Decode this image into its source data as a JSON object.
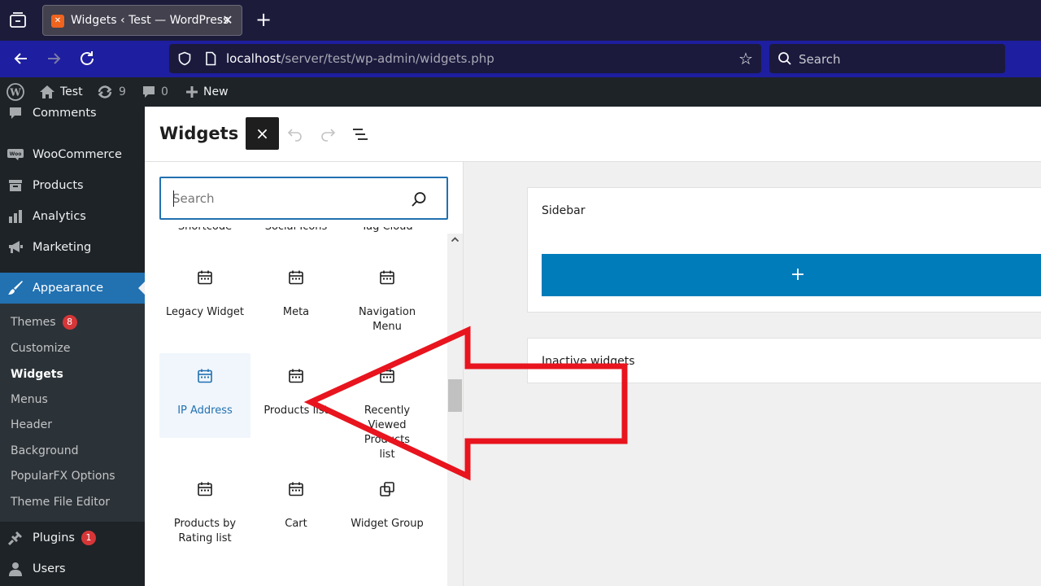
{
  "browser": {
    "tab_title": "Widgets ‹ Test — WordPress",
    "url_host": "localhost",
    "url_path": "/server/test/wp-admin/widgets.php",
    "search_placeholder": "Search"
  },
  "adminbar": {
    "site_name": "Test",
    "updates_count": "9",
    "comments_count": "0",
    "new_label": "New"
  },
  "sidebar": {
    "items": [
      {
        "label": "Comments",
        "icon": "comment-icon"
      },
      {
        "label": "WooCommerce",
        "icon": "woocommerce-icon"
      },
      {
        "label": "Products",
        "icon": "archive-icon"
      },
      {
        "label": "Analytics",
        "icon": "bar-chart-icon"
      },
      {
        "label": "Marketing",
        "icon": "megaphone-icon"
      },
      {
        "label": "Appearance",
        "icon": "paintbrush-icon"
      },
      {
        "label": "Plugins",
        "icon": "plug-icon",
        "badge": "1"
      },
      {
        "label": "Users",
        "icon": "user-icon"
      }
    ],
    "submenu": [
      {
        "label": "Themes",
        "badge": "8"
      },
      {
        "label": "Customize"
      },
      {
        "label": "Widgets"
      },
      {
        "label": "Menus"
      },
      {
        "label": "Header"
      },
      {
        "label": "Background"
      },
      {
        "label": "PopularFX Options"
      },
      {
        "label": "Theme File Editor"
      }
    ]
  },
  "editor": {
    "title": "Widgets",
    "close_label": "×",
    "search_placeholder": "Search"
  },
  "blocks": {
    "row0": [
      "Shortcode",
      "Social Icons",
      "Tag Cloud"
    ],
    "row1": [
      "Legacy Widget",
      "Meta",
      "Navigation Menu"
    ],
    "row2": [
      "IP Address",
      "Products list",
      "Recently Viewed Products list"
    ],
    "row3": [
      "Products by Rating list",
      "Cart",
      "Widget Group"
    ]
  },
  "widget_areas": {
    "sidebar_name": "Sidebar",
    "add_label": "+",
    "inactive_name": "Inactive widgets"
  },
  "colors": {
    "accent": "#2271b1",
    "add_button": "#007cba",
    "annotation_arrow": "#e8141e",
    "admin_bg": "#1d2327"
  }
}
